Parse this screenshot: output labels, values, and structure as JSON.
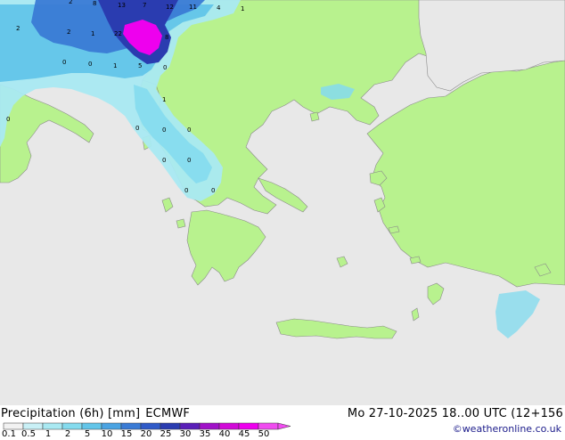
{
  "title": {
    "product": "Precipitation (6h) [mm]",
    "model": "ECMWF"
  },
  "valid_time": "Mo 27-10-2025 18..00 UTC (12+156",
  "credit": "©weatheronline.co.uk",
  "colors": {
    "sea": "#e8e8e8",
    "land": "#b8f28e",
    "coast": "#8a8a8a",
    "precip_light": "#a9e9f2",
    "precip_mid": "#7fd0ef",
    "precip_blue": "#3a7bd5",
    "precip_dark": "#2a3cb0",
    "precip_magenta": "#ee00ee"
  },
  "legend": {
    "ticks": [
      "0.1",
      "0.5",
      "1",
      "2",
      "5",
      "10",
      "15",
      "20",
      "25",
      "30",
      "35",
      "40",
      "45",
      "50"
    ],
    "colors": [
      "#f2f2f2",
      "#c9f0f6",
      "#a9e9f2",
      "#84dbee",
      "#62c5e9",
      "#4aa3e2",
      "#3a7bd5",
      "#2f5ac8",
      "#2a3cb0",
      "#5a1fb8",
      "#a012c8",
      "#d10ad8",
      "#ee00ee",
      "#f04cf0"
    ]
  },
  "map_labels": [
    {
      "id": "v1",
      "text": "2"
    },
    {
      "id": "v2",
      "text": "8"
    },
    {
      "id": "v3",
      "text": "13"
    },
    {
      "id": "v4",
      "text": "7"
    },
    {
      "id": "v5",
      "text": "12"
    },
    {
      "id": "v6",
      "text": "11"
    },
    {
      "id": "v7",
      "text": "4"
    },
    {
      "id": "v8",
      "text": "1"
    },
    {
      "id": "v9",
      "text": "2"
    },
    {
      "id": "v10",
      "text": "2"
    },
    {
      "id": "v11",
      "text": "1"
    },
    {
      "id": "v12",
      "text": "22"
    },
    {
      "id": "v13",
      "text": "8"
    },
    {
      "id": "v14",
      "text": "0"
    },
    {
      "id": "v15",
      "text": "0"
    },
    {
      "id": "v16",
      "text": "1"
    },
    {
      "id": "v17",
      "text": "5"
    },
    {
      "id": "v18",
      "text": "0"
    },
    {
      "id": "v19",
      "text": "1"
    },
    {
      "id": "v20",
      "text": "0"
    },
    {
      "id": "v21",
      "text": "0"
    },
    {
      "id": "v22",
      "text": "0"
    },
    {
      "id": "v23",
      "text": "0"
    },
    {
      "id": "v24",
      "text": "0"
    },
    {
      "id": "v25",
      "text": "0"
    },
    {
      "id": "v26",
      "text": "0"
    },
    {
      "id": "v27",
      "text": "0"
    }
  ]
}
